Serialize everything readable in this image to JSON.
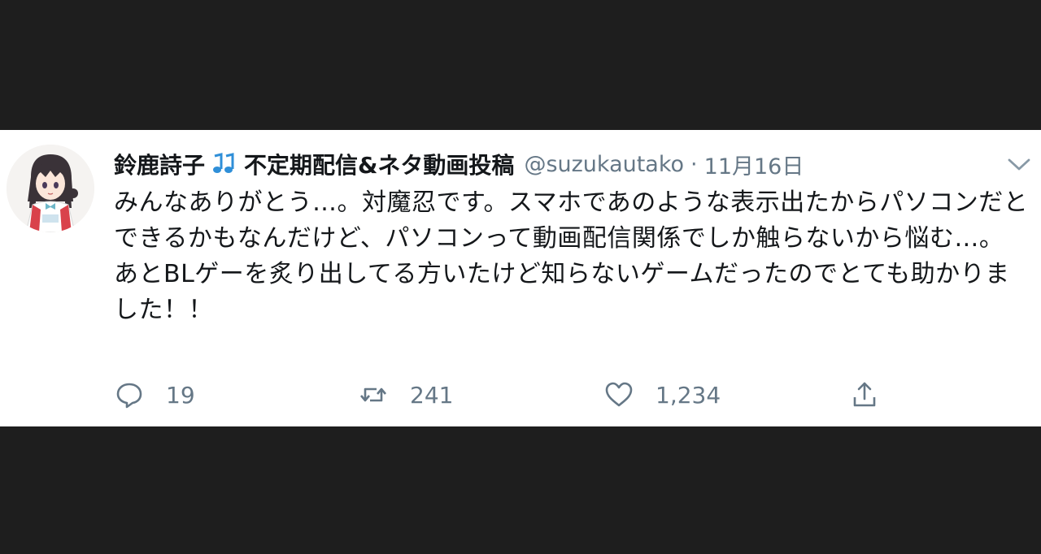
{
  "tweet": {
    "display_name": "鈴鹿詩子",
    "bio_name": "不定期配信&ネタ動画投稿",
    "handle": "@suzukautako",
    "separator": "·",
    "date": "11月16日",
    "text": "みんなありがとう…。対魔忍です。スマホであのような表示出たからパソコンだとできるかもなんだけど、パソコンって動画配信関係でしか触らないから悩む…。\nあとBLゲーを炙り出してる方いたけど知らないゲームだったのでとても助かりました！！",
    "accent_color": "#1da1f2",
    "text_color": "#14171a",
    "muted_color": "#657786"
  },
  "actions": {
    "reply": {
      "icon": "reply-icon",
      "count": "19"
    },
    "retweet": {
      "icon": "retweet-icon",
      "count": "241"
    },
    "like": {
      "icon": "heart-icon",
      "count": "1,234"
    },
    "share": {
      "icon": "share-icon"
    }
  },
  "menu": {
    "icon": "chevron-down-icon"
  }
}
